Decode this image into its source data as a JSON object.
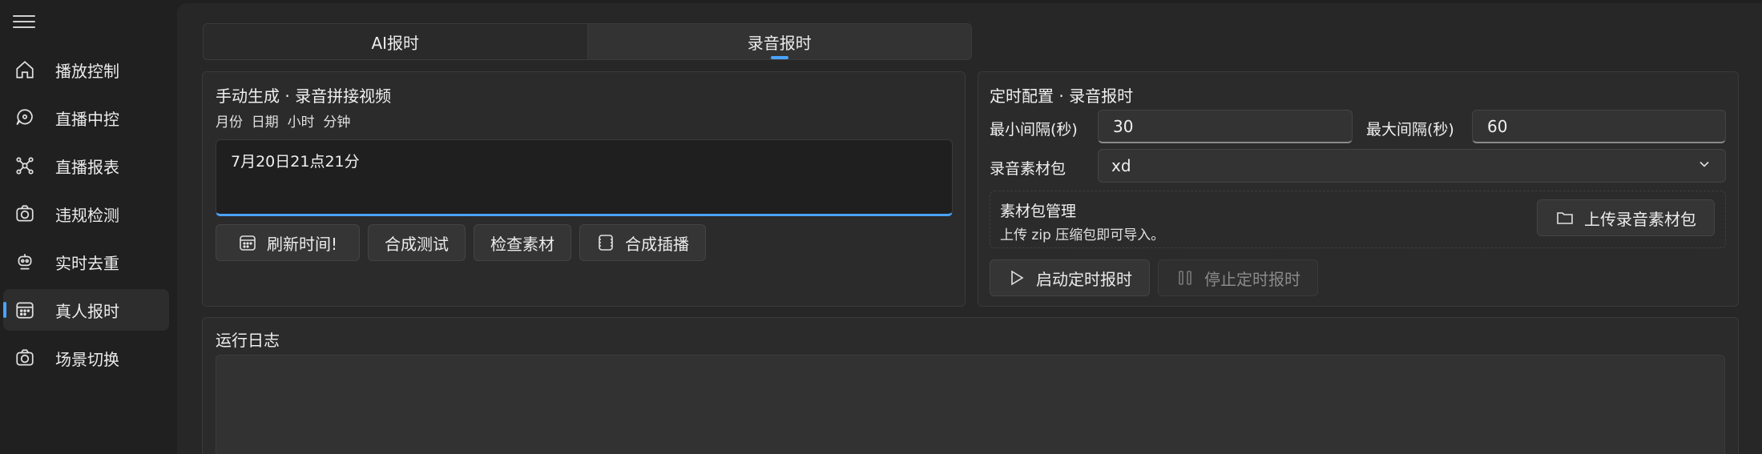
{
  "sidebar": {
    "items": [
      {
        "label": "播放控制",
        "icon": "home-icon"
      },
      {
        "label": "直播中控",
        "icon": "chat-icon"
      },
      {
        "label": "直播报表",
        "icon": "network-icon"
      },
      {
        "label": "违规检测",
        "icon": "camera-icon"
      },
      {
        "label": "实时去重",
        "icon": "robot-icon"
      },
      {
        "label": "真人报时",
        "icon": "calendar-icon",
        "active": true
      },
      {
        "label": "场景切换",
        "icon": "camera-icon"
      }
    ]
  },
  "tabs": [
    {
      "label": "AI报时"
    },
    {
      "label": "录音报时",
      "selected": true
    }
  ],
  "manual": {
    "title": "手动生成 · 录音拼接视频",
    "subtitle": "月份  日期  小时  分钟",
    "text_value": "7月20日21点21分",
    "buttons": {
      "refresh": "刷新时间!",
      "compose_test": "合成测试",
      "check_material": "检查素材",
      "compose_insert": "合成插播"
    }
  },
  "timer": {
    "title": "定时配置 · 录音报时",
    "min_label": "最小间隔(秒)",
    "min_value": "30",
    "max_label": "最大间隔(秒)",
    "max_value": "60",
    "pkg_label": "录音素材包",
    "pkg_value": "xd",
    "pkg_manage_title": "素材包管理",
    "pkg_manage_desc": "上传 zip 压缩包即可导入。",
    "upload_button": "上传录音素材包",
    "start_button": "启动定时报时",
    "stop_button": "停止定时报时"
  },
  "log": {
    "title": "运行日志"
  },
  "colors": {
    "accent": "#4aa3ff",
    "background": "#202020",
    "card": "#2b2b2b"
  }
}
